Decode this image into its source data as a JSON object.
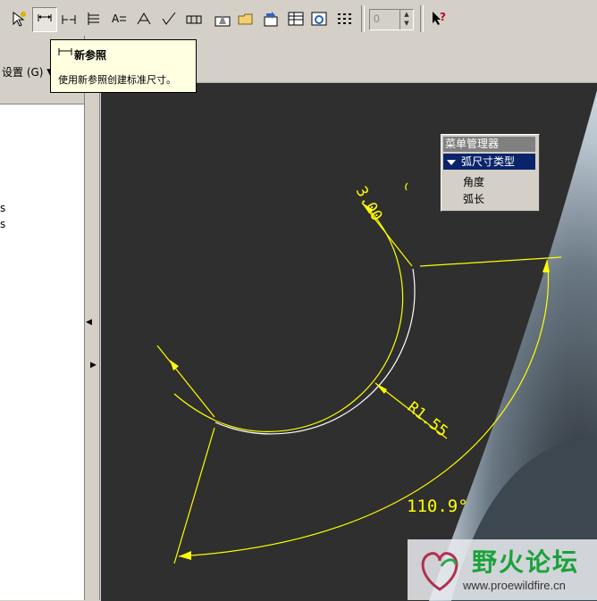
{
  "toolbar": {
    "buttons": [
      {
        "name": "dimension-icon",
        "glyph": "⊢⊣"
      },
      {
        "name": "new-reference-icon",
        "glyph": "⊢⊣"
      },
      {
        "name": "baseline-icon",
        "glyph": "⊣⊢"
      },
      {
        "name": "ordinate-icon",
        "glyph": "⇉"
      },
      {
        "name": "note-icon",
        "glyph": "A≡"
      },
      {
        "name": "weld-icon",
        "glyph": "⩘"
      },
      {
        "name": "surface-finish-icon",
        "glyph": "⩗"
      },
      {
        "name": "datum-icon",
        "glyph": "⊟"
      },
      {
        "name": "show-annotations-icon",
        "glyph": "⊜"
      },
      {
        "name": "folder-icon",
        "glyph": "▭"
      },
      {
        "name": "repeat-icon",
        "glyph": "⤾"
      },
      {
        "name": "table-icon",
        "glyph": "▦"
      },
      {
        "name": "regenerate-icon",
        "glyph": "⟳"
      },
      {
        "name": "grid-icon",
        "glyph": "⋮⋮"
      }
    ],
    "spinner_value": "0",
    "help_icon": "?"
  },
  "left_panel": {
    "settings_label": "设置 (G) ▼",
    "fragments": [
      "s",
      "s"
    ]
  },
  "tooltip": {
    "title": "新参照",
    "body": "使用新参照创建标准尺寸。"
  },
  "menu_manager": {
    "title": "菜单管理器",
    "header": "弧尺寸类型",
    "items": [
      "角度",
      "弧长"
    ]
  },
  "drawing": {
    "label_300": "3.00",
    "label_r155": "R1.55",
    "label_angle": "110.9°",
    "colors": {
      "dimension": "#ffff00",
      "geometry": "#ffffff",
      "background": "#2f2f2f"
    }
  },
  "watermark": {
    "title": "野火论坛",
    "url": "www.proewildfire.cn"
  }
}
